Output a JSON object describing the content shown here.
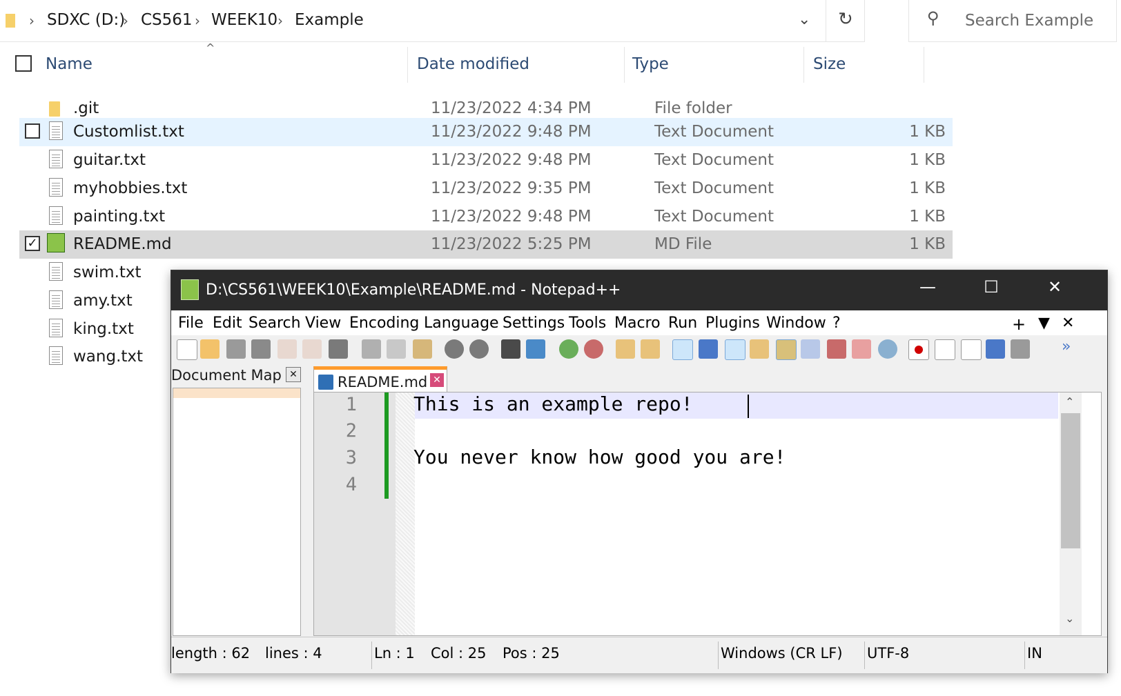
{
  "explorer": {
    "breadcrumb": [
      "SDXC (D:)",
      "CS561",
      "WEEK10",
      "Example"
    ],
    "search_placeholder": "Search Example",
    "columns": {
      "name": "Name",
      "date": "Date modified",
      "type": "Type",
      "size": "Size"
    },
    "files": [
      {
        "name": ".git",
        "date": "11/23/2022 4:34 PM",
        "type": "File folder",
        "size": "",
        "icon": "folder-icon"
      },
      {
        "name": "Customlist.txt",
        "date": "11/23/2022 9:48 PM",
        "type": "Text Document",
        "size": "1 KB",
        "icon": "text-file-icon"
      },
      {
        "name": "guitar.txt",
        "date": "11/23/2022 9:48 PM",
        "type": "Text Document",
        "size": "1 KB",
        "icon": "text-file-icon"
      },
      {
        "name": "myhobbies.txt",
        "date": "11/23/2022 9:35 PM",
        "type": "Text Document",
        "size": "1 KB",
        "icon": "text-file-icon"
      },
      {
        "name": "painting.txt",
        "date": "11/23/2022 9:48 PM",
        "type": "Text Document",
        "size": "1 KB",
        "icon": "text-file-icon"
      },
      {
        "name": "README.md",
        "date": "11/23/2022 5:25 PM",
        "type": "MD File",
        "size": "1 KB",
        "icon": "notepadpp-file-icon"
      },
      {
        "name": "swim.txt",
        "icon": "text-file-icon"
      },
      {
        "name": "amy.txt",
        "icon": "text-file-icon"
      },
      {
        "name": "king.txt",
        "icon": "text-file-icon"
      },
      {
        "name": "wang.txt",
        "icon": "text-file-icon"
      }
    ]
  },
  "notepad": {
    "title": "D:\\CS561\\WEEK10\\Example\\README.md - Notepad++",
    "menu": [
      "File",
      "Edit",
      "Search",
      "View",
      "Encoding",
      "Language",
      "Settings",
      "Tools",
      "Macro",
      "Run",
      "Plugins",
      "Window",
      "?"
    ],
    "document_map_label": "Document Map",
    "tab_label": "README.md",
    "lines": [
      "This is an example repo!",
      "",
      "You never know how good you are!",
      ""
    ],
    "line_numbers": [
      "1",
      "2",
      "3",
      "4"
    ],
    "status": {
      "length": "length : 62",
      "lines": "lines : 4",
      "ln": "Ln : 1",
      "col": "Col : 25",
      "pos": "Pos : 25",
      "eol": "Windows (CR LF)",
      "encoding": "UTF-8",
      "mode": "IN"
    }
  }
}
